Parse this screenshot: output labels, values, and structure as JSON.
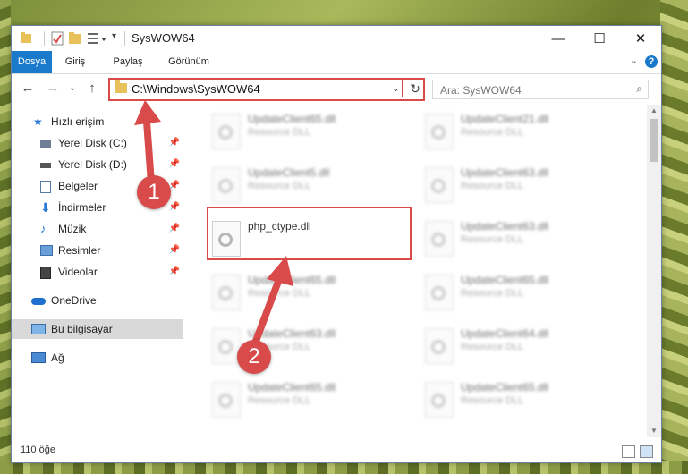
{
  "window": {
    "title": "SysWOW64"
  },
  "ribbon": {
    "tabs": [
      "Dosya",
      "Giriş",
      "Paylaş",
      "Görünüm"
    ],
    "help": "?"
  },
  "nav": {
    "address_path": "C:\\Windows\\SysWOW64",
    "search_placeholder": "Ara: SysWOW64"
  },
  "sidebar": {
    "items": [
      {
        "label": "Hızlı erişim",
        "icon": "star-icon"
      },
      {
        "label": "Yerel Disk (C:)",
        "icon": "drive-icon"
      },
      {
        "label": "Yerel Disk (D:)",
        "icon": "drive-icon"
      },
      {
        "label": "Belgeler",
        "icon": "documents-icon"
      },
      {
        "label": "İndirmeler",
        "icon": "download-icon"
      },
      {
        "label": "Müzik",
        "icon": "music-icon"
      },
      {
        "label": "Resimler",
        "icon": "pictures-icon"
      },
      {
        "label": "Videolar",
        "icon": "videos-icon"
      },
      {
        "label": "OneDrive",
        "icon": "cloud-icon"
      },
      {
        "label": "Bu bilgisayar",
        "icon": "computer-icon"
      },
      {
        "label": "Ağ",
        "icon": "network-icon"
      }
    ]
  },
  "files": {
    "col1": [
      {
        "name": "UpdateClient65.dll",
        "type": "Resource DLL"
      },
      {
        "name": "UpdateClient5.dll",
        "type": "Resource DLL"
      },
      {
        "name": "php_ctype.dll",
        "type": ""
      },
      {
        "name": "UpdateClient65.dll",
        "type": "Resource DLL"
      },
      {
        "name": "UpdateClient63.dll",
        "type": "Resource DLL"
      },
      {
        "name": "UpdateClient65.dll",
        "type": "Resource DLL"
      }
    ],
    "col2": [
      {
        "name": "UpdateClient21.dll",
        "type": "Resource DLL"
      },
      {
        "name": "UpdateClient63.dll",
        "type": "Resource DLL"
      },
      {
        "name": "UpdateClient63.dll",
        "type": "Resource DLL"
      },
      {
        "name": "UpdateClient65.dll",
        "type": "Resource DLL"
      },
      {
        "name": "UpdateClient64.dll",
        "type": "Resource DLL"
      },
      {
        "name": "UpdateClient65.dll",
        "type": "Resource DLL"
      }
    ]
  },
  "status": {
    "count": "110 öğe"
  },
  "annotations": {
    "badge1": "1",
    "badge2": "2",
    "color": "#d94a4a"
  }
}
